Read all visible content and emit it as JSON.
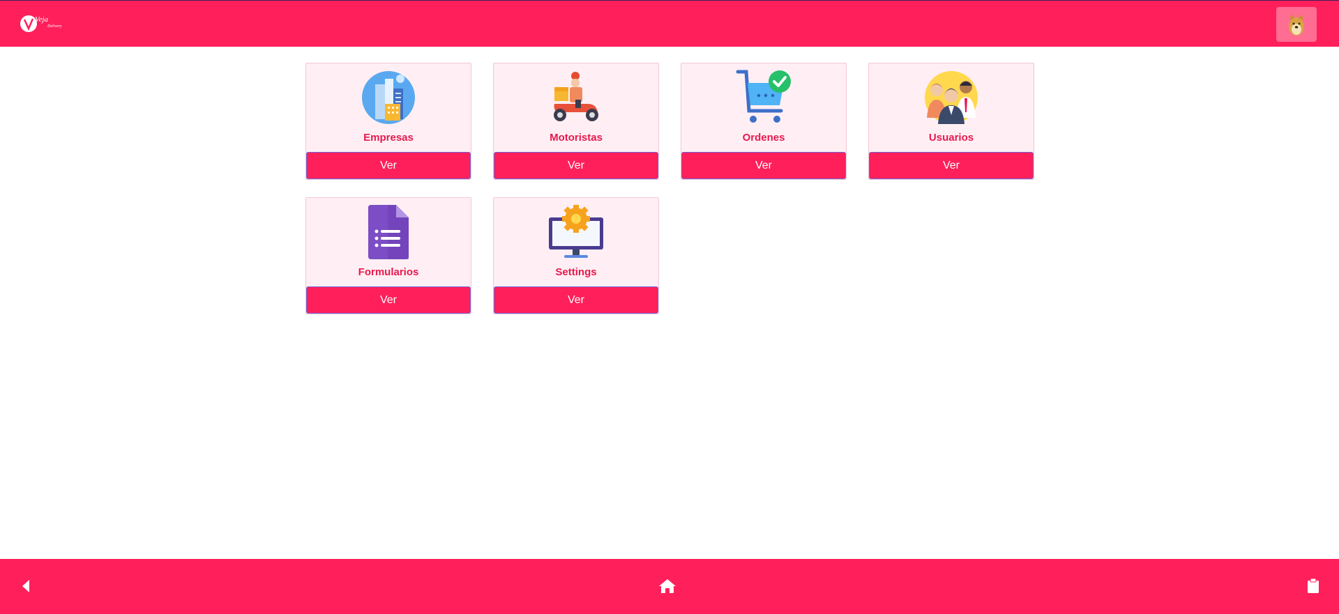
{
  "header": {
    "logo_text": "Veja",
    "logo_subtext": "Delivery",
    "avatar_icon": "doge-avatar-icon"
  },
  "cards": [
    {
      "label": "Empresas",
      "button": "Ver",
      "icon": "buildings-icon"
    },
    {
      "label": "Motoristas",
      "button": "Ver",
      "icon": "delivery-scooter-icon"
    },
    {
      "label": "Ordenes",
      "button": "Ver",
      "icon": "shopping-cart-check-icon"
    },
    {
      "label": "Usuarios",
      "button": "Ver",
      "icon": "users-group-icon"
    },
    {
      "label": "Formularios",
      "button": "Ver",
      "icon": "form-document-icon"
    },
    {
      "label": "Settings",
      "button": "Ver",
      "icon": "monitor-gear-icon"
    }
  ],
  "footer": {
    "back_icon": "back-arrow-icon",
    "home_icon": "home-icon",
    "clipboard_icon": "clipboard-icon"
  },
  "colors": {
    "brand": "#ff1f5a",
    "card_bg": "#ffeff4",
    "card_label": "#e8194f",
    "button_border": "#6f63d8"
  }
}
